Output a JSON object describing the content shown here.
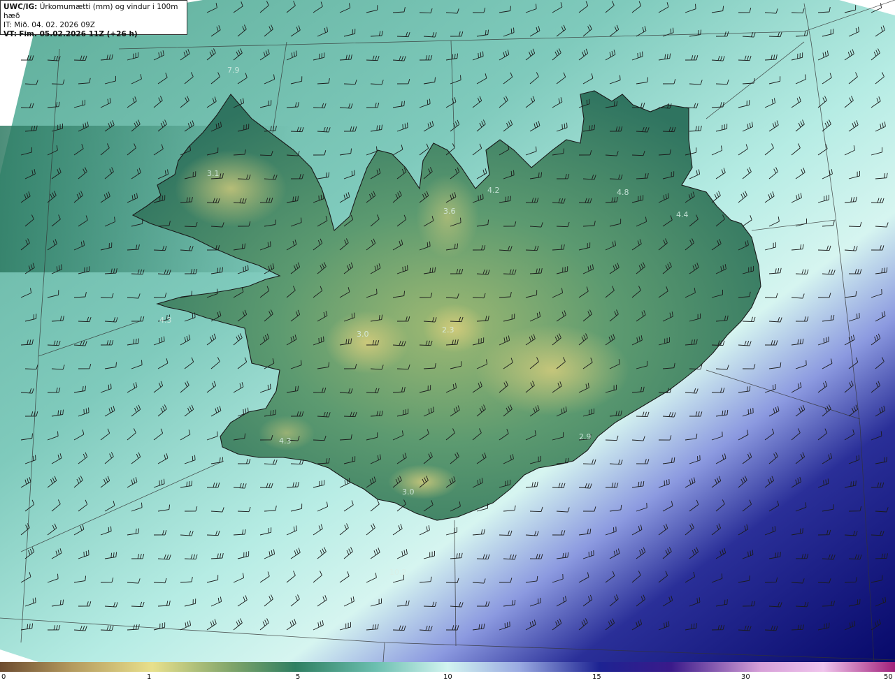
{
  "header": {
    "product": "UWC/IG:",
    "title": "Úrkomumætti (mm) og vindur i 100m hæð",
    "issue_time": "IT: Mið. 04. 02. 2026 09Z",
    "valid_prefix": "VT:",
    "valid_time": "Fim. 05.02.2026 11Z (+26 h)"
  },
  "colorbar": {
    "ticks": [
      "0",
      "1",
      "5",
      "10",
      "15",
      "30",
      "50"
    ],
    "colors": [
      "#7a5a3a",
      "#c9b86a",
      "#e6e08a",
      "#3c8a66",
      "#8fd2c6",
      "#cdf2ee",
      "#9aa8e0",
      "#1a1e8a",
      "#0b0b6a",
      "#8a2aa0",
      "#d8a0d8",
      "#f4d0f0"
    ]
  },
  "map": {
    "ocean_gradient": [
      "#7fc9bd",
      "#a4e0d6",
      "#d2f6f2",
      "#a9b7ea",
      "#2b2f96",
      "#0a0c6c"
    ],
    "land_colors": [
      "#2e6f5a",
      "#4c8d6a",
      "#8fb06e",
      "#c8c478"
    ],
    "value_labels": [
      "7.9",
      "3.1",
      "3.6",
      "4.8",
      "4.4",
      "4.3",
      "3.0",
      "2.3",
      "4.3",
      "2.9",
      "3.0",
      "10.2",
      "4.2"
    ]
  }
}
